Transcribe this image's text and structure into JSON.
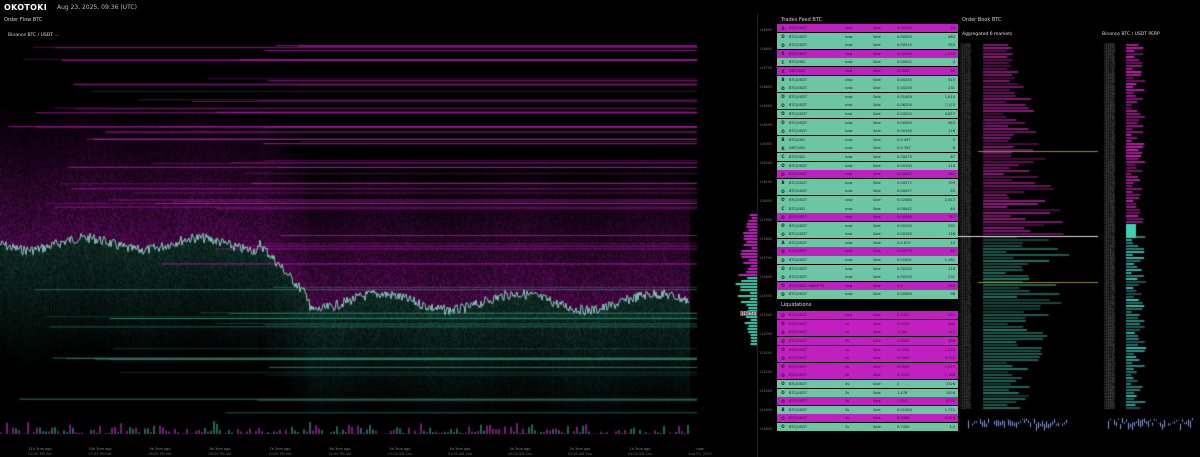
{
  "app": {
    "brand": "OKOTOKI",
    "datetime": "Aug 23, 2025, 09:36 (UTC)"
  },
  "orderflow": {
    "title": "Order Flow BTC",
    "exchange": "Binance BTC / USDT ...",
    "current_price": "115640",
    "time_axis": [
      {
        "label": "11h 3nm ago",
        "date": "02:00 PM Sat"
      },
      {
        "label": "10h 3nm ago",
        "date": "07:00 PM Sat"
      },
      {
        "label": "9h 3nm ago",
        "date": "08:00 PM Sat"
      },
      {
        "label": "8h 3nm ago",
        "date": "09:00 PM Sat"
      },
      {
        "label": "7h 3nm ago",
        "date": "10:00 PM Sat"
      },
      {
        "label": "6h 3nm ago",
        "date": "11:00 PM Sat"
      },
      {
        "label": "5h 3nm ago",
        "date": "12:00 AM Sun"
      },
      {
        "label": "4h 3nm ago",
        "date": "01:00 AM Sun"
      },
      {
        "label": "3h 3nm ago",
        "date": "02:00 AM Sun"
      },
      {
        "label": "2h 3nm ago",
        "date": "03:00 AM Sun"
      },
      {
        "label": "1h 3nm ago",
        "date": "04:00 AM Sun"
      },
      {
        "label": "now",
        "date": "Aug 23, 2025"
      }
    ],
    "colors": {
      "bid": "#3fd0b0",
      "ask": "#c020c0",
      "trade": "#7de8c8"
    }
  },
  "ladder": {
    "prices": [
      "116900",
      "116800",
      "116700",
      "116600",
      "116500",
      "116400",
      "116300",
      "116200",
      "116100",
      "116000",
      "115900",
      "115800",
      "115700",
      "115600",
      "115500",
      "115400",
      "115300",
      "115200",
      "115100",
      "115000",
      "114900",
      "114800"
    ]
  },
  "trades": {
    "title": "Trades Feed BTC",
    "rows": [
      {
        "side": "sell",
        "icon": "B",
        "symbol": "BTC/USDT",
        "age": "now",
        "dir": "Sale",
        "qty": "0.01000",
        "val": "20"
      },
      {
        "side": "buy",
        "icon": "O",
        "symbol": "BTC/USDT",
        "age": "now",
        "dir": "Sale",
        "qty": "0.00000",
        "val": "463"
      },
      {
        "side": "buy",
        "icon": "O",
        "symbol": "BTC/USDT",
        "age": "now",
        "dir": "Sale",
        "qty": "0.00010",
        "val": "350"
      },
      {
        "side": "sell",
        "icon": "B",
        "symbol": "BTC/USDT",
        "age": "now",
        "dir": "Sale",
        "qty": "0.01000",
        "val": "1,250"
      },
      {
        "side": "buy",
        "icon": "C",
        "symbol": "BTC/USD",
        "age": "now",
        "dir": "Sale",
        "qty": "0.00001",
        "val": "4"
      },
      {
        "side": "sell",
        "icon": "K",
        "symbol": "XBT/USD",
        "age": "now",
        "dir": "Sale",
        "qty": "0.0000",
        "val": "66"
      },
      {
        "side": "buy",
        "icon": "B",
        "symbol": "BTC/USDT",
        "age": "now",
        "dir": "Sale",
        "qty": "0.00255",
        "val": "315"
      },
      {
        "side": "buy",
        "icon": "O",
        "symbol": "BTC/USDT",
        "age": "now",
        "dir": "Sale",
        "qty": "0.00200",
        "val": "231"
      },
      {
        "side": "buy",
        "icon": "O",
        "symbol": "BTC/USDT",
        "age": "now",
        "dir": "Sale",
        "qty": "0.01400",
        "val": "1,610"
      },
      {
        "side": "buy",
        "icon": "O",
        "symbol": "BTC/USDT",
        "age": "now",
        "dir": "Sale",
        "qty": "0.06200",
        "val": "7,170"
      },
      {
        "side": "buy",
        "icon": "O",
        "symbol": "BTC/USDT",
        "age": "now",
        "dir": "Sale",
        "qty": "0.04200",
        "val": "4,857"
      },
      {
        "side": "buy",
        "icon": "O",
        "symbol": "BTC/USDT",
        "age": "now",
        "dir": "Sale",
        "qty": "0.00400",
        "val": "463"
      },
      {
        "side": "buy",
        "icon": "O",
        "symbol": "BTC/USDT",
        "age": "now",
        "dir": "Sale",
        "qty": "0.00100",
        "val": "116"
      },
      {
        "side": "buy",
        "icon": "B",
        "symbol": "BTC/USD",
        "age": "now",
        "dir": "Sale",
        "qty": "0.0.497",
        "val": "5"
      },
      {
        "side": "buy",
        "icon": "K",
        "symbol": "XBT/USD",
        "age": "now",
        "dir": "Sale",
        "qty": "0.0.767",
        "val": "8"
      },
      {
        "side": "buy",
        "icon": "C",
        "symbol": "BTC/USD",
        "age": "now",
        "dir": "Sale",
        "qty": "0.00075",
        "val": "87"
      },
      {
        "side": "buy",
        "icon": "O",
        "symbol": "BTC/USDT",
        "age": "now",
        "dir": "Sale",
        "qty": "0.00100",
        "val": "116"
      },
      {
        "side": "sell",
        "icon": "O",
        "symbol": "BTC/USDT",
        "age": "now",
        "dir": "Sale",
        "qty": "0.00067",
        "val": "382"
      },
      {
        "side": "buy",
        "icon": "B",
        "symbol": "BTC/USDT",
        "age": "now",
        "dir": "Sale",
        "qty": "0.00572",
        "val": "199"
      },
      {
        "side": "buy",
        "icon": "O",
        "symbol": "BTC/USDT",
        "age": "now",
        "dir": "Sale",
        "qty": "0.00057",
        "val": "55"
      },
      {
        "side": "buy",
        "icon": "O",
        "symbol": "BTC/USDT",
        "age": "now",
        "dir": "Sale",
        "qty": "0.02080",
        "val": "2,413"
      },
      {
        "side": "buy",
        "icon": "C",
        "symbol": "BTC/USD",
        "age": "now",
        "dir": "Sale",
        "qty": "0.00042",
        "val": "44"
      },
      {
        "side": "sell",
        "icon": "O",
        "symbol": "BTC/USDT",
        "age": "now",
        "dir": "Sale",
        "qty": "0.00380",
        "val": "767"
      },
      {
        "side": "buy",
        "icon": "O",
        "symbol": "BTC/USDT",
        "age": "now",
        "dir": "Sale",
        "qty": "0.00200",
        "val": "231"
      },
      {
        "side": "buy",
        "icon": "O",
        "symbol": "BTC/USDT",
        "age": "now",
        "dir": "Sale",
        "qty": "0.00100",
        "val": "116"
      },
      {
        "side": "buy",
        "icon": "A",
        "symbol": "BTC/USDT",
        "age": "now",
        "dir": "Sale",
        "qty": "0.0.870",
        "val": "10"
      },
      {
        "side": "sell",
        "icon": "O",
        "symbol": "BTC/USDT",
        "age": "now",
        "dir": "Sale",
        "qty": "0.00073",
        "val": "82"
      },
      {
        "side": "buy",
        "icon": "O",
        "symbol": "BTC/USDT",
        "age": "now",
        "dir": "Sale",
        "qty": "0.01001",
        "val": "1,161"
      },
      {
        "side": "buy",
        "icon": "O",
        "symbol": "BTC/USDT",
        "age": "now",
        "dir": "Sale",
        "qty": "0.00100",
        "val": "116"
      },
      {
        "side": "buy",
        "icon": "O",
        "symbol": "BTC/USDT",
        "age": "now",
        "dir": "Sale",
        "qty": "0.00200",
        "val": "231"
      },
      {
        "side": "sell",
        "icon": "O",
        "symbol": "BTC/USDC SWAP PS",
        "age": "now",
        "dir": "Sale",
        "qty": "0.0",
        "val": "285"
      },
      {
        "side": "buy",
        "icon": "O",
        "symbol": "BTC/USDT",
        "age": "now",
        "dir": "Sale",
        "qty": "0.00084",
        "val": "96"
      }
    ]
  },
  "liquidations": {
    "title": "Liquidations",
    "rows": [
      {
        "side": "sell",
        "icon": "O",
        "symbol": "BTC/USDT",
        "age": "now",
        "dir": "Sale",
        "qty": "0.2000",
        "val": "231"
      },
      {
        "side": "sell",
        "icon": "O",
        "symbol": "BTC/USDT",
        "age": "2s",
        "dir": "Sale",
        "qty": "0.0420",
        "val": "486"
      },
      {
        "side": "sell",
        "icon": "O",
        "symbol": "BTC/USDT",
        "age": "2s",
        "dir": "Sale",
        "qty": "1.262",
        "val": "151"
      },
      {
        "side": "sell",
        "icon": "O",
        "symbol": "BTC/USDT",
        "age": "2s",
        "dir": "Sale",
        "qty": "0.0500",
        "val": "386"
      },
      {
        "side": "sell",
        "icon": "O",
        "symbol": "BTC/USDT",
        "age": "2s",
        "dir": "Sale",
        "qty": "0.0200",
        "val": "1,220"
      },
      {
        "side": "sell",
        "icon": "O",
        "symbol": "BTC/USDT",
        "age": "2s",
        "dir": "Sale",
        "qty": "0.0500",
        "val": "5,752"
      },
      {
        "side": "sell",
        "icon": "O",
        "symbol": "BTC/USDT",
        "age": "3s",
        "dir": "Sale",
        "qty": "0.0000",
        "val": "1,571"
      },
      {
        "side": "sell",
        "icon": "O",
        "symbol": "BTC/USDT",
        "age": "3s",
        "dir": "Sale",
        "qty": "0.0100",
        "val": "1,168"
      },
      {
        "side": "buy",
        "icon": "O",
        "symbol": "BTC/USDT",
        "age": "3s",
        "dir": "Sale",
        "qty": "2",
        "val": "2326"
      },
      {
        "side": "buy",
        "icon": "O",
        "symbol": "BTC/USDT",
        "age": "3s",
        "dir": "Sale",
        "qty": "1.478",
        "val": "1926"
      },
      {
        "side": "sell",
        "icon": "O",
        "symbol": "BTC/USDT",
        "age": "3s",
        "dir": "Sale",
        "qty": "1.510",
        "val": "3738"
      },
      {
        "side": "buy",
        "icon": "B",
        "symbol": "BTC/USDT",
        "age": "3s",
        "dir": "Sale",
        "qty": "0.01000",
        "val": "1,771"
      },
      {
        "side": "sell",
        "icon": "O",
        "symbol": "BTC/USDT",
        "age": "3s",
        "dir": "Sale",
        "qty": "0.0300",
        "val": "3,470"
      },
      {
        "side": "buy",
        "icon": "O",
        "symbol": "BTC/USDT",
        "age": "3s",
        "dir": "Sale",
        "qty": "0.7400",
        "val": "3,9"
      }
    ]
  },
  "orderbook": {
    "title": "Order Book BTC",
    "aggregated": "Aggregated 6 markets",
    "binance": "Binance BTC / USDT  PERP",
    "mid_price": "115640",
    "colors": {
      "bid": "#3fd0b0",
      "ask": "#c020c0"
    }
  }
}
